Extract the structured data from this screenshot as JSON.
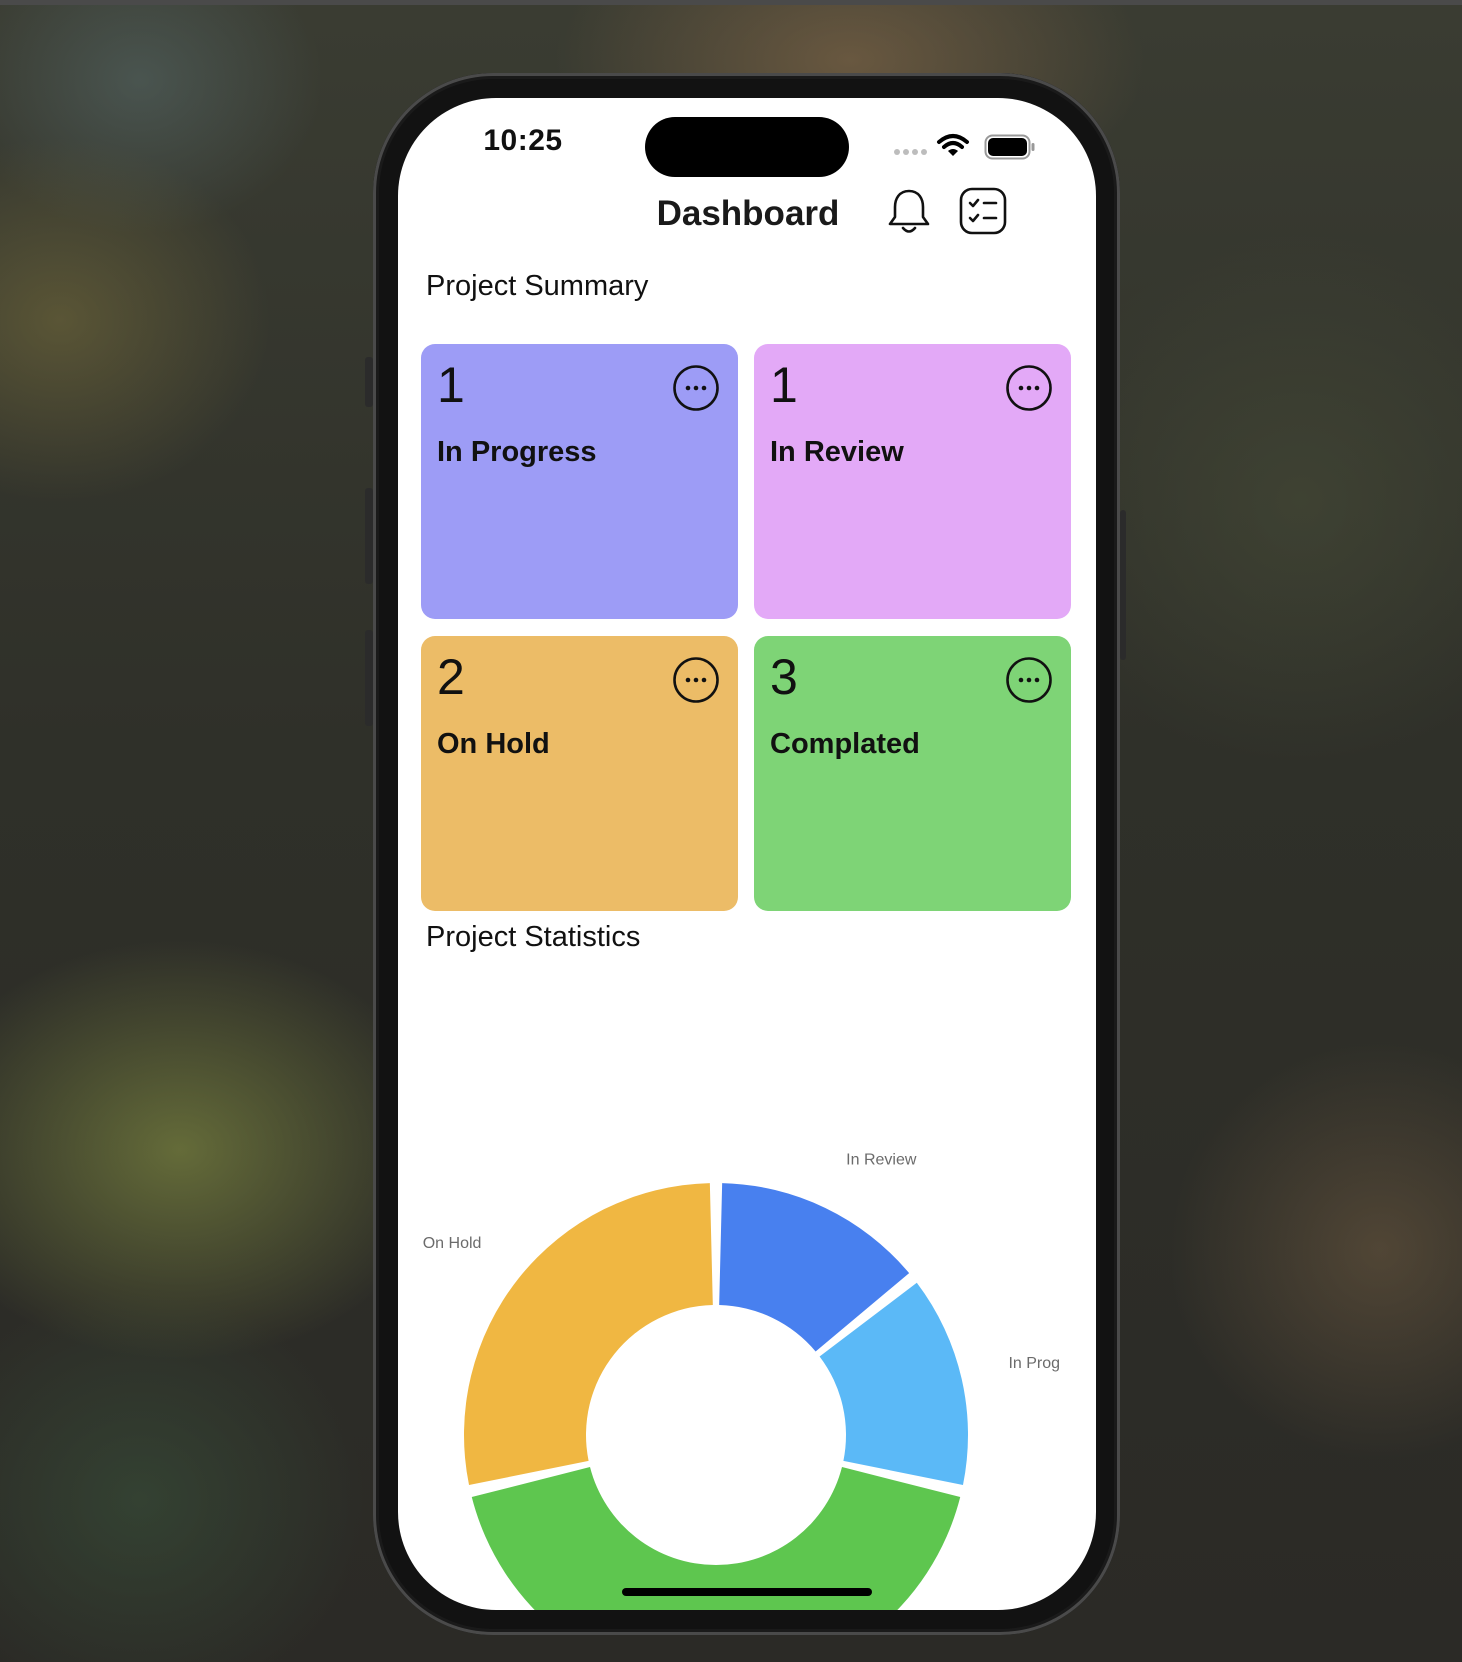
{
  "status_bar": {
    "time": "10:25"
  },
  "header": {
    "title": "Dashboard",
    "icons": [
      "bell-icon",
      "checklist-icon"
    ]
  },
  "summary": {
    "title": "Project Summary",
    "cards": [
      {
        "count": "1",
        "label": "In Progress",
        "color": "#9D9CF6"
      },
      {
        "count": "1",
        "label": "In Review",
        "color": "#E3A9F7"
      },
      {
        "count": "2",
        "label": "On Hold",
        "color": "#ECBC67"
      },
      {
        "count": "3",
        "label": "Complated",
        "color": "#7ED476"
      }
    ]
  },
  "statistics": {
    "title": "Project Statistics"
  },
  "chart_data": {
    "type": "pie",
    "donut": true,
    "categories": [
      "In Review",
      "In Progress",
      "Completed",
      "On Hold"
    ],
    "values": [
      1,
      1,
      3,
      2
    ],
    "colors": [
      "#4880EF",
      "#5BB9F7",
      "#5EC64F",
      "#F0B742"
    ],
    "slice_labels": [
      "In Review",
      "In Prog",
      "",
      "On Hold"
    ]
  }
}
